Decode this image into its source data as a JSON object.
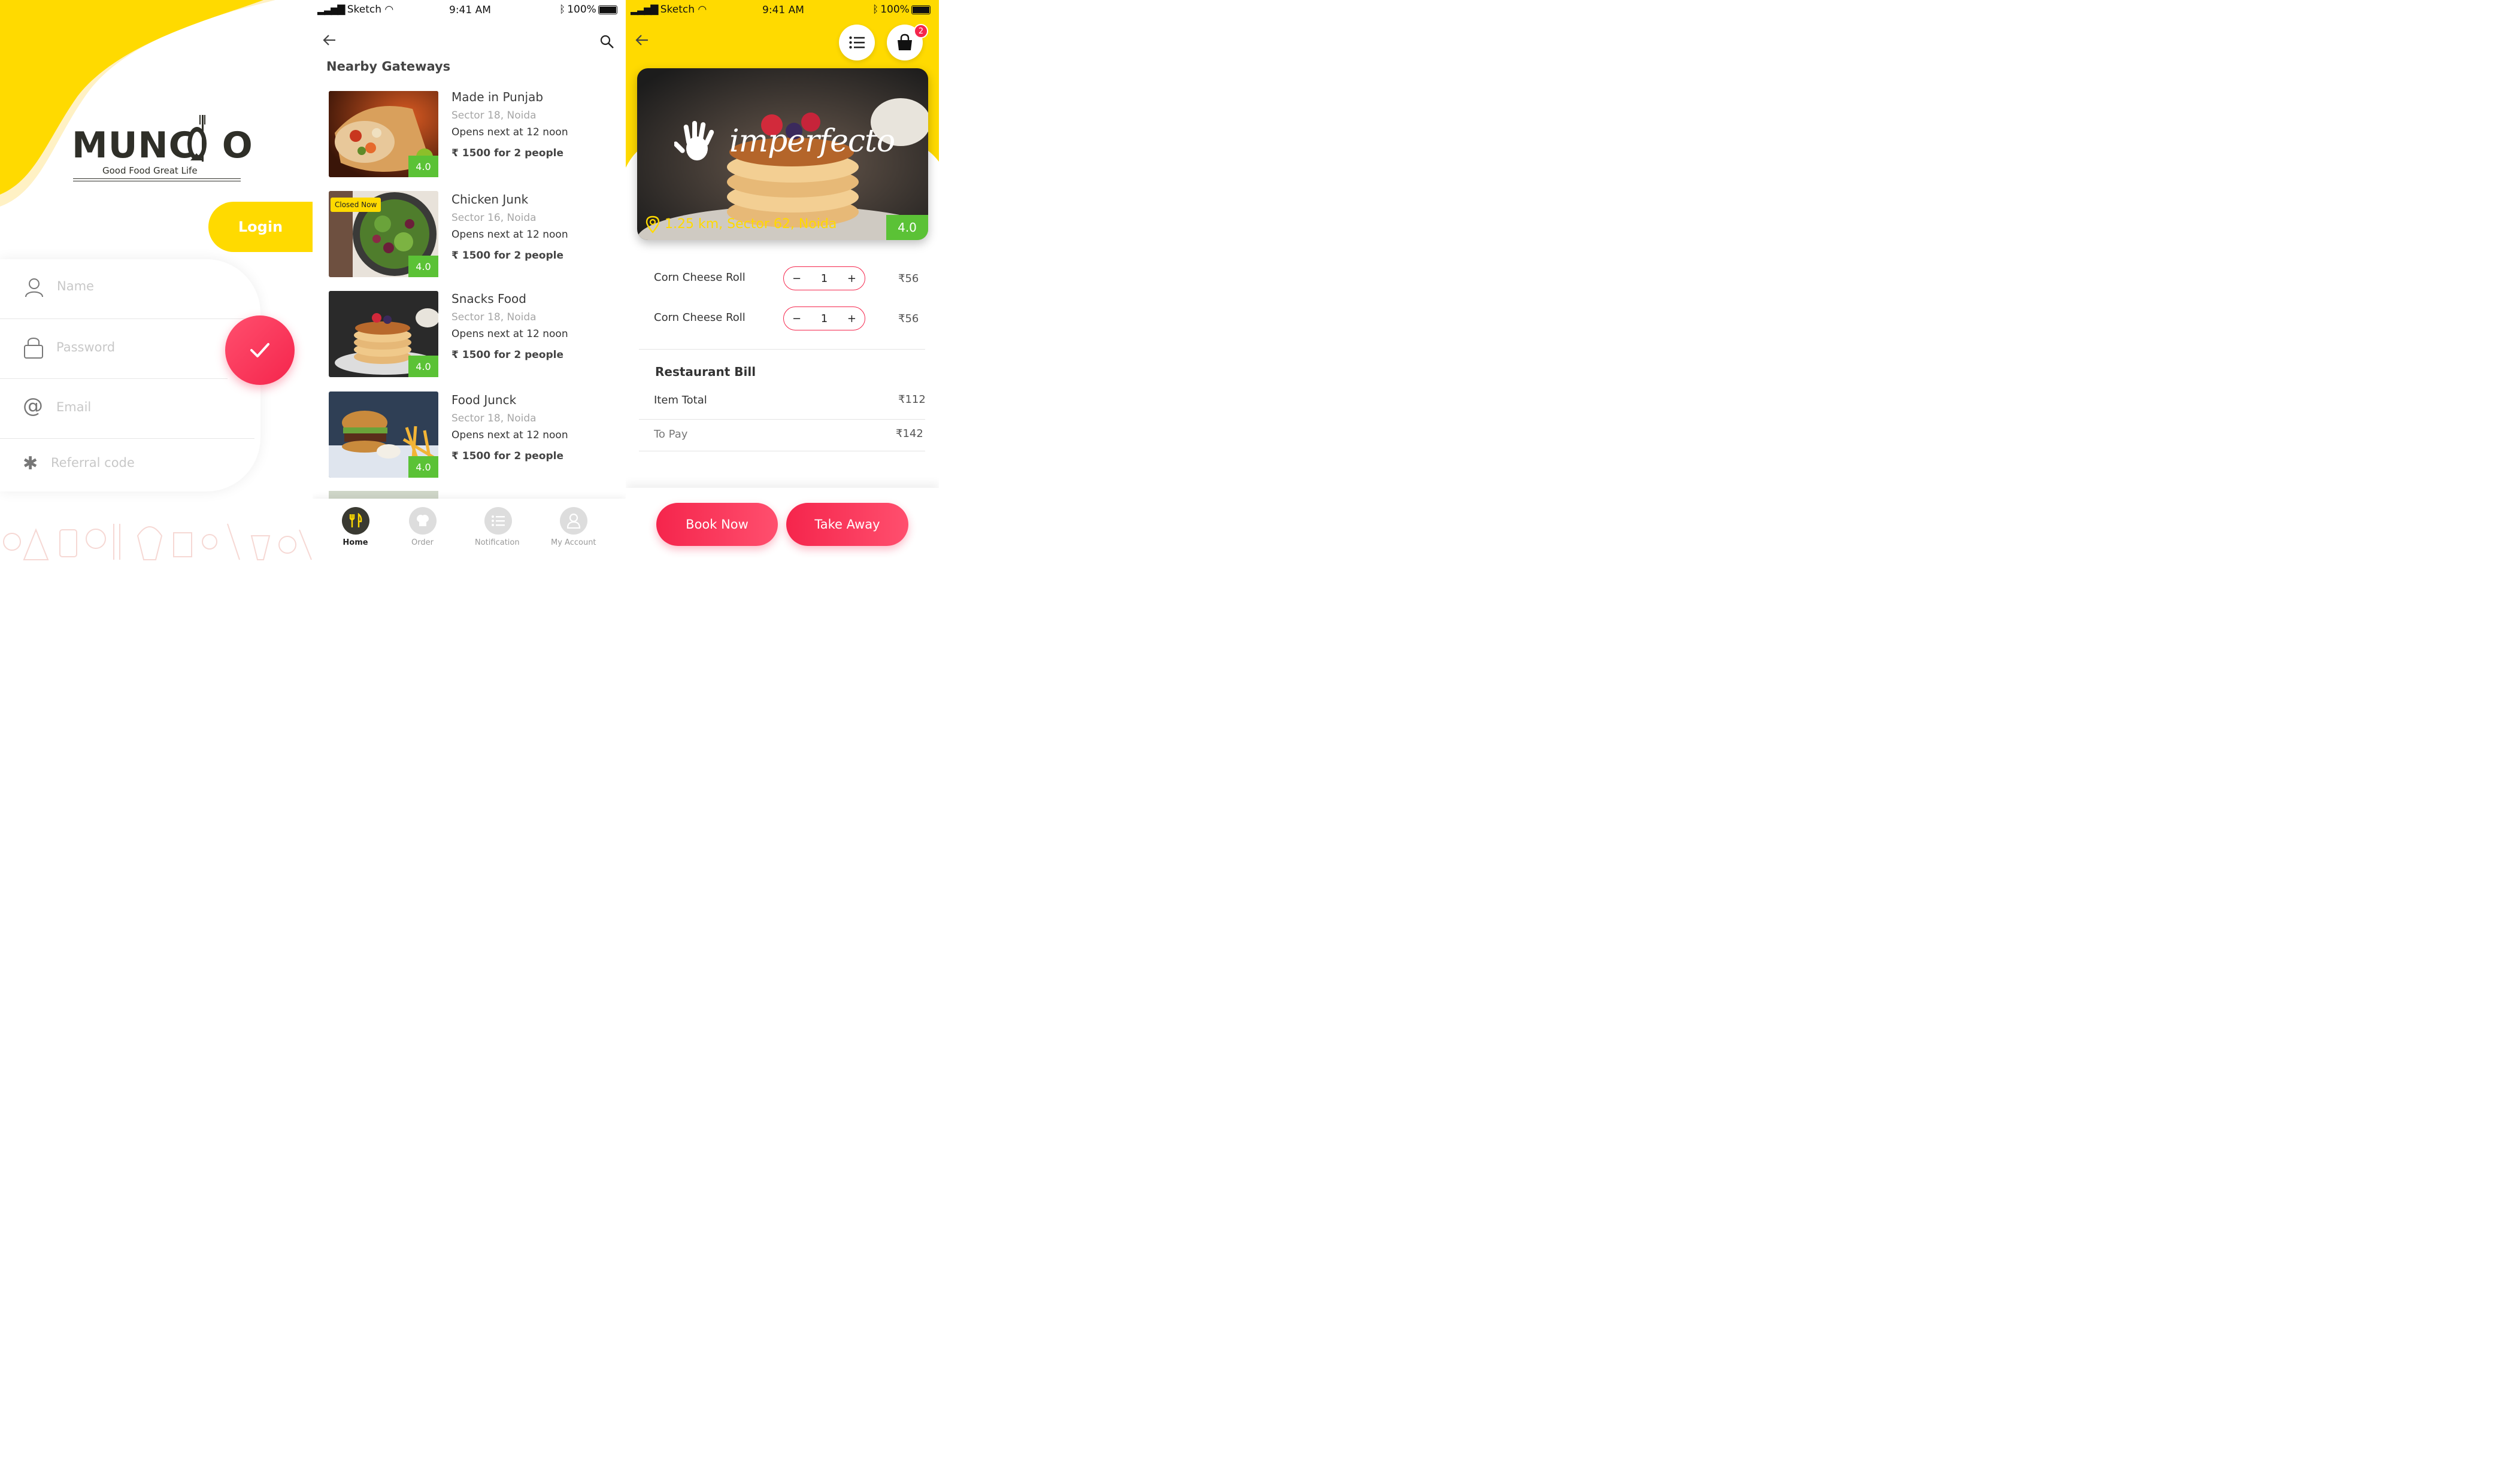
{
  "colors": {
    "accent": "#FFDA00",
    "primary": "#F5254C",
    "rating_green": "#5BC236"
  },
  "signup": {
    "brand": {
      "name_left": "MUNC",
      "name_right": "O",
      "tagline": "Good Food Great Life"
    },
    "login_label": "Login",
    "fields": [
      {
        "icon": "user-icon",
        "placeholder": "Name"
      },
      {
        "icon": "lock-icon",
        "placeholder": "Password"
      },
      {
        "icon": "at-icon",
        "placeholder": "Email"
      },
      {
        "icon": "asterisk-icon",
        "placeholder": "Referral code"
      }
    ],
    "submit_icon": "check-icon"
  },
  "status_bar": {
    "carrier": "Sketch",
    "time": "9:41 AM",
    "battery": "100%"
  },
  "listing": {
    "title": "Nearby Gateways",
    "restaurants": [
      {
        "name": "Made in Punjab",
        "location": "Sector 18, Noida",
        "hours": "Opens next at 12 noon",
        "price": "₹ 1500 for 2 people",
        "rating": "4.0",
        "tag": ""
      },
      {
        "name": "Chicken Junk",
        "location": "Sector 16, Noida",
        "hours": "Opens next at 12 noon",
        "price": "₹ 1500 for 2 people",
        "rating": "4.0",
        "tag": "Closed Now"
      },
      {
        "name": "Snacks Food",
        "location": "Sector 18, Noida",
        "hours": "Opens next at 12 noon",
        "price": "₹ 1500 for 2 people",
        "rating": "4.0",
        "tag": ""
      },
      {
        "name": "Food Junck",
        "location": "Sector 18, Noida",
        "hours": "Opens next at 12 noon",
        "price": "₹ 1500 for 2 people",
        "rating": "4.0",
        "tag": ""
      }
    ],
    "tabs": [
      {
        "label": "Home",
        "icon": "fork-knife-icon",
        "active": true
      },
      {
        "label": "Order",
        "icon": "chef-hat-icon",
        "active": false
      },
      {
        "label": "Notification",
        "icon": "list-icon",
        "active": false
      },
      {
        "label": "My Account",
        "icon": "person-icon",
        "active": false
      }
    ]
  },
  "detail": {
    "cart_count": "2",
    "restaurant_name": "imperfecto",
    "distance": "1.25 km, Sector 62, Noida",
    "rating": "4.0",
    "items": [
      {
        "name": "Corn Cheese Roll",
        "qty": "1",
        "price": "₹56"
      },
      {
        "name": "Corn Cheese Roll",
        "qty": "1",
        "price": "₹56"
      }
    ],
    "bill": {
      "title": "Restaurant Bill",
      "item_total_label": "Item Total",
      "item_total": "₹112",
      "to_pay_label": "To Pay",
      "to_pay": "₹142"
    },
    "book_now": "Book Now",
    "take_away": "Take Away"
  }
}
